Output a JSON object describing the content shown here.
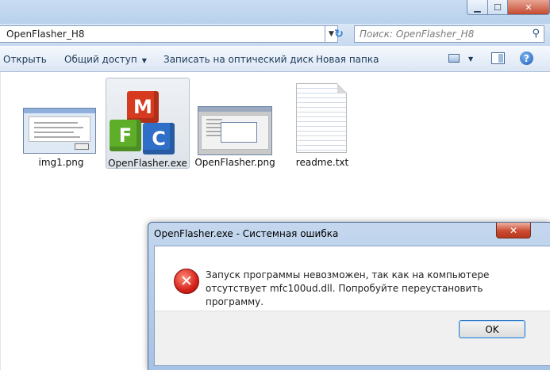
{
  "window": {
    "minimize_glyph": "▁",
    "maximize_glyph": "☐",
    "close_glyph": "✕"
  },
  "address_bar": {
    "path": "OpenFlasher_H8",
    "search_placeholder": "Поиск: OpenFlasher_H8"
  },
  "command_bar": {
    "items": [
      "Открыть",
      "Общий доступ",
      "Записать на оптический диск",
      "Новая папка"
    ]
  },
  "files": [
    {
      "name": "img1.png",
      "icon": "screenshot-thumbnail"
    },
    {
      "name": "OpenFlasher.exe",
      "icon": "mfc-cubes-icon",
      "selected": true
    },
    {
      "name": "OpenFlasher.png",
      "icon": "screenshot-thumbnail"
    },
    {
      "name": "readme.txt",
      "icon": "text-document-icon"
    }
  ],
  "mfc_letters": [
    "M",
    "F",
    "C"
  ],
  "dialog": {
    "title": "OpenFlasher.exe - Системная ошибка",
    "message": "Запуск программы невозможен, так как на компьютере отсутствует mfc100ud.dll. Попробуйте переустановить программу.",
    "ok_label": "OK",
    "close_glyph": "✕"
  },
  "colors": {
    "mfc_m": "#d63a1f",
    "mfc_f": "#5fae2a",
    "mfc_c": "#2f6fc8",
    "error_red": "#d6221a",
    "accent_blue": "#2f79c9"
  }
}
